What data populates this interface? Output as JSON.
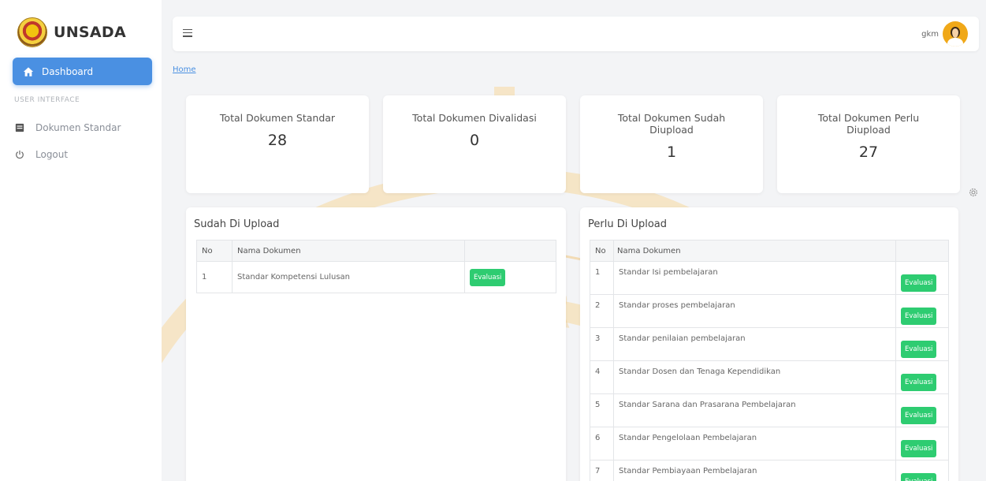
{
  "brand": {
    "name": "UNSADA"
  },
  "sidebar": {
    "active_item": "Dashboard",
    "section_label": "USER INTERFACE",
    "items": [
      {
        "label": "Dokumen Standar",
        "icon": "document-icon"
      },
      {
        "label": "Logout",
        "icon": "power-icon"
      }
    ]
  },
  "topbar": {
    "user_name": "gkm"
  },
  "breadcrumb": "Home",
  "stats": [
    {
      "title": "Total Dokumen Standar",
      "value": "28"
    },
    {
      "title": "Total Dokumen Divalidasi",
      "value": "0"
    },
    {
      "title": "Total Dokumen Sudah Diupload",
      "value": "1"
    },
    {
      "title": "Total Dokumen Perlu Diupload",
      "value": "27"
    }
  ],
  "uploaded": {
    "title": "Sudah Di Upload",
    "headers": [
      "No",
      "Nama Dokumen",
      ""
    ],
    "rows": [
      {
        "no": "1",
        "name": "Standar Kompetensi Lulusan",
        "action": "Evaluasi"
      }
    ]
  },
  "pending": {
    "title": "Perlu Di Upload",
    "headers": [
      "No",
      "Nama Dokumen",
      ""
    ],
    "rows": [
      {
        "no": "1",
        "name": "Standar Isi pembelajaran",
        "action": "Evaluasi"
      },
      {
        "no": "2",
        "name": "Standar proses pembelajaran",
        "action": "Evaluasi"
      },
      {
        "no": "3",
        "name": "Standar penilaian pembelajaran",
        "action": "Evaluasi"
      },
      {
        "no": "4",
        "name": "Standar Dosen dan Tenaga Kependidikan",
        "action": "Evaluasi"
      },
      {
        "no": "5",
        "name": "Standar Sarana dan Prasarana Pembelajaran",
        "action": "Evaluasi"
      },
      {
        "no": "6",
        "name": "Standar Pengelolaan Pembelajaran",
        "action": "Evaluasi"
      },
      {
        "no": "7",
        "name": "Standar Pembiayaan Pembelajaran",
        "action": "Evaluasi"
      }
    ]
  },
  "colors": {
    "primary": "#4a90e2",
    "success": "#2ecc71",
    "watermark": "#f3c77a"
  }
}
